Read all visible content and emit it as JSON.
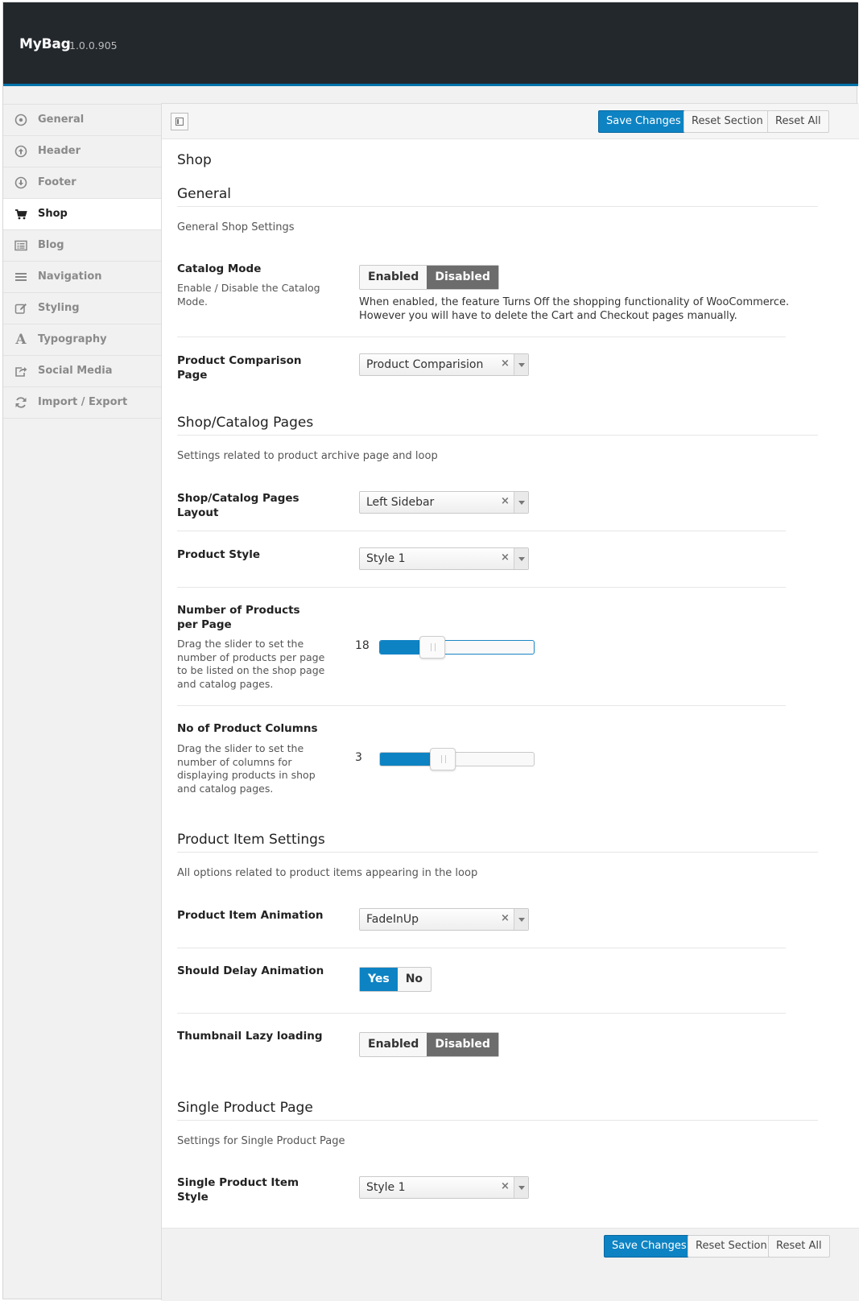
{
  "header": {
    "brand": "MyBag",
    "version": "1.0.0.905"
  },
  "sidebar": {
    "items": [
      {
        "label": "General",
        "icon": "circle-dot-icon",
        "active": false
      },
      {
        "label": "Header",
        "icon": "arrow-up-circle-icon",
        "active": false
      },
      {
        "label": "Footer",
        "icon": "arrow-down-circle-icon",
        "active": false
      },
      {
        "label": "Shop",
        "icon": "cart-icon",
        "active": true
      },
      {
        "label": "Blog",
        "icon": "list-box-icon",
        "active": false
      },
      {
        "label": "Navigation",
        "icon": "menu-icon",
        "active": false
      },
      {
        "label": "Styling",
        "icon": "edit-icon",
        "active": false
      },
      {
        "label": "Typography",
        "icon": "font-icon",
        "active": false
      },
      {
        "label": "Social Media",
        "icon": "share-icon",
        "active": false
      },
      {
        "label": "Import / Export",
        "icon": "refresh-icon",
        "active": false
      }
    ]
  },
  "toolbar": {
    "save": "Save Changes",
    "reset_section": "Reset Section",
    "reset_all": "Reset All"
  },
  "page": {
    "title": "Shop"
  },
  "sections": {
    "general": {
      "title": "General",
      "desc": "General Shop Settings",
      "catalog_mode": {
        "label": "Catalog Mode",
        "desc": "Enable / Disable the Catalog Mode.",
        "opt_on": "Enabled",
        "opt_off": "Disabled",
        "selected": "Disabled",
        "help_1": "When enabled, the feature Turns Off the shopping functionality of WooCommerce.",
        "help_2": "However you will have to delete the Cart and Checkout pages manually."
      },
      "comparison": {
        "label": "Product Comparison Page",
        "value": "Product Comparision"
      }
    },
    "catalog": {
      "title": "Shop/Catalog Pages",
      "desc": "Settings related to product archive page and loop",
      "layout": {
        "label": "Shop/Catalog Pages Layout",
        "value": "Left Sidebar"
      },
      "style": {
        "label": "Product Style",
        "value": "Style 1"
      },
      "per_page": {
        "label": "Number of Products per Page",
        "desc": "Drag the slider to set the number of products per page to be listed on the shop page and catalog pages.",
        "value": "18",
        "fill_fraction": 0.34
      },
      "columns": {
        "label": "No of Product Columns",
        "desc": "Drag the slider to set the number of columns for displaying products in shop and catalog pages.",
        "value": "3",
        "fill_fraction": 0.41
      }
    },
    "item": {
      "title": "Product Item Settings",
      "desc": "All options related to product items appearing in the loop",
      "animation": {
        "label": "Product Item Animation",
        "value": "FadeInUp"
      },
      "delay": {
        "label": "Should Delay Animation",
        "opt_on": "Yes",
        "opt_off": "No",
        "selected": "Yes"
      },
      "lazy": {
        "label": "Thumbnail Lazy loading",
        "opt_on": "Enabled",
        "opt_off": "Disabled",
        "selected": "Disabled"
      }
    },
    "single": {
      "title": "Single Product Page",
      "desc": "Settings for Single Product Page",
      "item_style": {
        "label": "Single Product Item Style",
        "value": "Style 1"
      }
    }
  },
  "colors": {
    "accent": "#0d83c3",
    "topbar": "#23282d",
    "switch_active_dark": "#6c6c6c"
  }
}
